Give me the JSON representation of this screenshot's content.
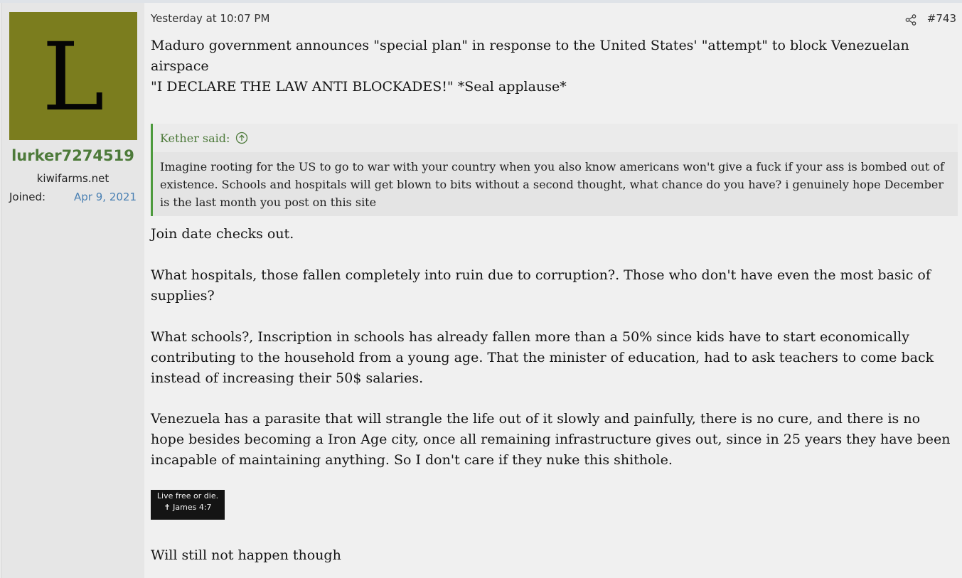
{
  "user": {
    "avatar_letter": "L",
    "avatar_color": "#7b7d1e",
    "username": "lurker7274519",
    "title": "kiwifarms.net",
    "joined_label": "Joined:",
    "joined_date": "Apr 9, 2021"
  },
  "post": {
    "timestamp": "Yesterday at 10:07 PM",
    "number": "#743",
    "share_icon": "share-icon",
    "para1": "Maduro government announces \"special plan\" in response to the United States' \"attempt\" to block Venezuelan airspace",
    "para2": "\"I DECLARE THE LAW ANTI BLOCKADES!\" *Seal applause*",
    "quote": {
      "author": "Kether said:",
      "icon": "arrow-up-circle-icon",
      "text": "Imagine rooting for the US to go to war with your country when you also know americans won't give a fuck if your ass is bombed out of existence. Schools and hospitals will get blown to bits without a second thought, what chance do you have? i genuinely hope December is the last month you post on this site"
    },
    "para3": "Join date checks out.",
    "para4": "What hospitals, those fallen completely into ruin due to corruption?. Those who don't have even the most basic of supplies?",
    "para5": "What schools?, Inscription in schools has already fallen more than a 50% since kids have to start economically contributing to the household from a young age. That the minister of education, had to ask teachers to come back instead of increasing their 50$ salaries.",
    "para6": "Venezuela has a parasite that will strangle the life out of it slowly and painfully, there is no cure, and there is no hope besides becoming a Iron Age city, once all remaining infrastructure gives out, since in 25 years they have been incapable of maintaining anything. So I don't care if they nuke this shithole.",
    "signature_line1": "Live free or die.",
    "signature_line2": "✝ James 4:7",
    "para7": "Will still not happen though"
  },
  "colors": {
    "username": "#4d7a3a",
    "link": "#4a80b3",
    "quote_border": "#4d9a3d"
  }
}
